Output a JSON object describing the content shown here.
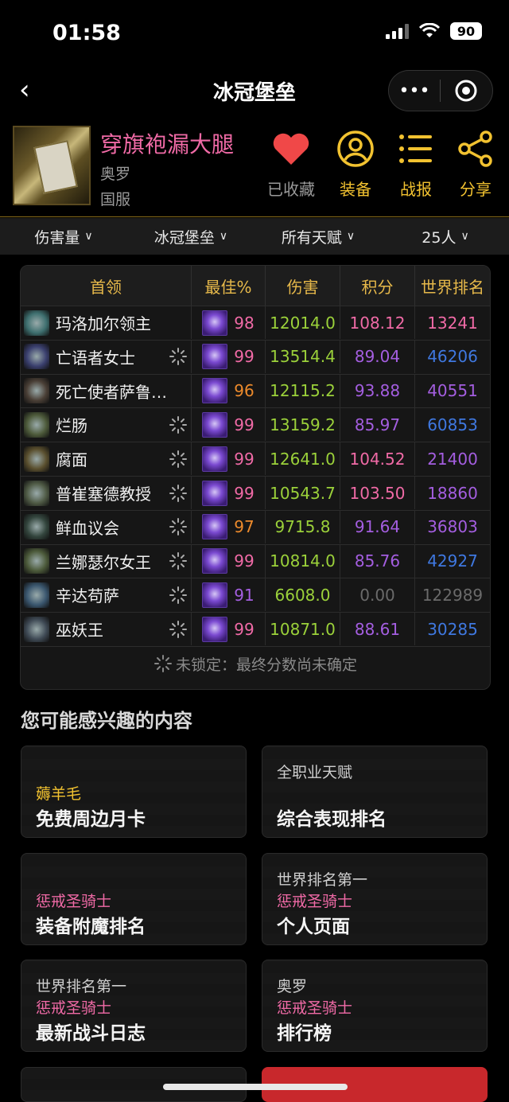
{
  "status": {
    "time": "01:58",
    "battery": "90"
  },
  "nav": {
    "title": "冰冠堡垒"
  },
  "profile": {
    "name": "穿旗袍漏大腿",
    "realm": "奥罗",
    "region": "国服"
  },
  "actions": [
    {
      "label": "已收藏",
      "icon": "heart-icon",
      "color": "#f04848"
    },
    {
      "label": "装备",
      "icon": "user-circle-icon",
      "color": "#f2c230"
    },
    {
      "label": "战报",
      "icon": "list-icon",
      "color": "#f2c230"
    },
    {
      "label": "分享",
      "icon": "share-icon",
      "color": "#f2c230"
    }
  ],
  "filters": [
    "伤害量",
    "冰冠堡垒",
    "所有天赋",
    "25人"
  ],
  "table": {
    "headers": [
      "首领",
      "最佳%",
      "伤害",
      "积分",
      "世界排名"
    ],
    "rows": [
      {
        "boss": "玛洛加尔领主",
        "locked": false,
        "best": "98",
        "dmg": "12014.0",
        "score": "108.12",
        "rank": "13241",
        "best_color": "#f06aa6",
        "score_color": "#f06aa6",
        "rank_color": "#f06aa6",
        "icon_color": "#3e6f6f"
      },
      {
        "boss": "亡语者女士",
        "locked": true,
        "best": "99",
        "dmg": "13514.4",
        "score": "89.04",
        "rank": "46206",
        "best_color": "#f06aa6",
        "score_color": "#a45ee0",
        "rank_color": "#3f78e0",
        "icon_color": "#3a3f6e"
      },
      {
        "boss": "死亡使者萨鲁…",
        "locked": false,
        "best": "96",
        "dmg": "12115.2",
        "score": "93.88",
        "rank": "40551",
        "best_color": "#ec8a2c",
        "score_color": "#a45ee0",
        "rank_color": "#a45ee0",
        "icon_color": "#4a3f36"
      },
      {
        "boss": "烂肠",
        "locked": true,
        "best": "99",
        "dmg": "13159.2",
        "score": "85.97",
        "rank": "60853",
        "best_color": "#f06aa6",
        "score_color": "#a45ee0",
        "rank_color": "#3f78e0",
        "icon_color": "#4d5a3a"
      },
      {
        "boss": "腐面",
        "locked": true,
        "best": "99",
        "dmg": "12641.0",
        "score": "104.52",
        "rank": "21400",
        "best_color": "#f06aa6",
        "score_color": "#f06aa6",
        "rank_color": "#a45ee0",
        "icon_color": "#5a4f2e"
      },
      {
        "boss": "普崔塞德教授",
        "locked": true,
        "best": "99",
        "dmg": "10543.7",
        "score": "103.50",
        "rank": "18860",
        "best_color": "#f06aa6",
        "score_color": "#f06aa6",
        "rank_color": "#a45ee0",
        "icon_color": "#4f5a45"
      },
      {
        "boss": "鲜血议会",
        "locked": true,
        "best": "97",
        "dmg": "9715.8",
        "score": "91.64",
        "rank": "36803",
        "best_color": "#ec8a2c",
        "score_color": "#a45ee0",
        "rank_color": "#a45ee0",
        "icon_color": "#33453d"
      },
      {
        "boss": "兰娜瑟尔女王",
        "locked": true,
        "best": "99",
        "dmg": "10814.0",
        "score": "85.76",
        "rank": "42927",
        "best_color": "#f06aa6",
        "score_color": "#a45ee0",
        "rank_color": "#3f78e0",
        "icon_color": "#4c5a3a"
      },
      {
        "boss": "辛达苟萨",
        "locked": true,
        "best": "91",
        "dmg": "6608.0",
        "score": "0.00",
        "rank": "122989",
        "best_color": "#a45ee0",
        "score_color": "#6a6a6a",
        "rank_color": "#6a6a6a",
        "icon_color": "#3a566e"
      },
      {
        "boss": "巫妖王",
        "locked": true,
        "best": "99",
        "dmg": "10871.0",
        "score": "88.61",
        "rank": "30285",
        "best_color": "#f06aa6",
        "score_color": "#a45ee0",
        "rank_color": "#3f78e0",
        "icon_color": "#3f4a55"
      }
    ],
    "note": "未锁定：最终分数尚未确定"
  },
  "interest": {
    "title": "您可能感兴趣的内容",
    "cards": [
      {
        "line1": "",
        "line2": "薅羊毛",
        "line3": "免费周边月卡",
        "line2_color": "#f2c230"
      },
      {
        "line1": "全职业天赋",
        "line2": "",
        "line3": "综合表现排名",
        "line2_color": "#f06aa6"
      },
      {
        "line1": "",
        "line2": "惩戒圣骑士",
        "line3": "装备附魔排名",
        "line2_color": "#f06aa6"
      },
      {
        "line1": "世界排名第一",
        "line2": "惩戒圣骑士",
        "line3": "个人页面",
        "line2_color": "#f06aa6"
      },
      {
        "line1": "世界排名第一",
        "line2": "惩戒圣骑士",
        "line3": "最新战斗日志",
        "line2_color": "#f06aa6"
      },
      {
        "line1": "奥罗",
        "line2": "惩戒圣骑士",
        "line3": "排行榜",
        "line2_color": "#f06aa6"
      }
    ]
  }
}
